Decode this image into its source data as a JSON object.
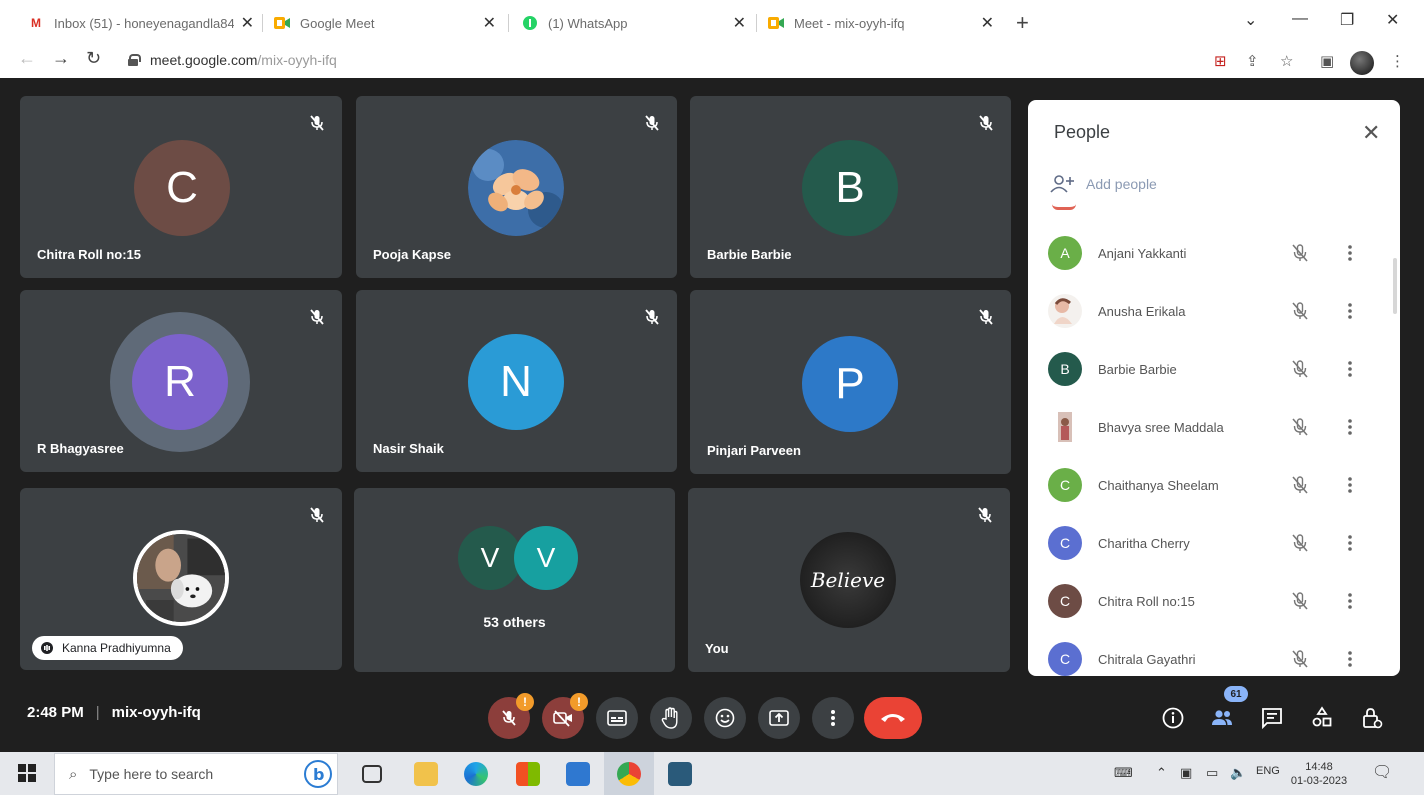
{
  "browser": {
    "tabs": [
      {
        "title": "Inbox (51) - honeyenagandla84",
        "icon": "gmail-icon"
      },
      {
        "title": "Google Meet",
        "icon": "meet-icon"
      },
      {
        "title": "(1) WhatsApp",
        "icon": "whatsapp-icon"
      },
      {
        "title": "Meet - mix-oyyh-ifq",
        "icon": "meet-icon"
      }
    ],
    "close_glyph": "✕",
    "new_tab_glyph": "+",
    "url_host": "meet.google.com",
    "url_path": "/mix-oyyh-ifq"
  },
  "tiles": [
    {
      "name": "Chitra Roll no:15",
      "initial": "C",
      "color": "#6d4c45"
    },
    {
      "name": "Pooja Kapse",
      "initial": "",
      "color": "#3d6ea8",
      "picture": "flower-photo"
    },
    {
      "name": "Barbie Barbie",
      "initial": "B",
      "color": "#245a4c"
    },
    {
      "name": "R Bhagyasree",
      "initial": "R",
      "color": "#7c62cc"
    },
    {
      "name": "Nasir Shaik",
      "initial": "N",
      "color": "#2a9bd6"
    },
    {
      "name": "Pinjari Parveen",
      "initial": "P",
      "color": "#2d79c8"
    },
    {
      "name": "Kanna Pradhiyumna",
      "initial": "",
      "color": "#5a5a5a",
      "picture": "dog-photo"
    },
    {
      "name": "53 others",
      "initials": [
        "V",
        "V"
      ],
      "colors": [
        "#245a4c",
        "#17a0a0"
      ]
    },
    {
      "name": "You",
      "initial": "",
      "color": "#2a2a2a",
      "picture": "believe-photo",
      "picture_text": "Believe"
    }
  ],
  "people_panel": {
    "title": "People",
    "close_glyph": "✕",
    "add_people": "Add people",
    "people": [
      {
        "name": "Anjani Yakkanti",
        "initial": "A",
        "color": "#6aaf48"
      },
      {
        "name": "Anusha Erikala",
        "initial": "",
        "color": "#e8d6c9",
        "picture": "sketch-photo"
      },
      {
        "name": "Barbie Barbie",
        "initial": "B",
        "color": "#245a4c"
      },
      {
        "name": "Bhavya sree Maddala",
        "initial": "",
        "color": "#c9a7a1",
        "picture": "portrait-photo"
      },
      {
        "name": "Chaithanya Sheelam",
        "initial": "C",
        "color": "#6aaf48"
      },
      {
        "name": "Charitha Cherry",
        "initial": "C",
        "color": "#5b6fd1"
      },
      {
        "name": "Chitra Roll no:15",
        "initial": "C",
        "color": "#6d4c45"
      },
      {
        "name": "Chitrala Gayathri",
        "initial": "C",
        "color": "#5b6fd1"
      }
    ]
  },
  "bottom_bar": {
    "time": "2:48 PM",
    "separator": "|",
    "meeting_code": "mix-oyyh-ifq",
    "warn_glyph": "!",
    "participant_count": "61"
  },
  "taskbar": {
    "search_placeholder": "Type here to search",
    "language": "ENG",
    "time": "14:48",
    "date": "01-03-2023"
  },
  "colors": {
    "meet_bg": "#1f1f1f",
    "tile_bg": "#3c4043",
    "hangup": "#ea4335",
    "warning": "#f29b2a"
  }
}
